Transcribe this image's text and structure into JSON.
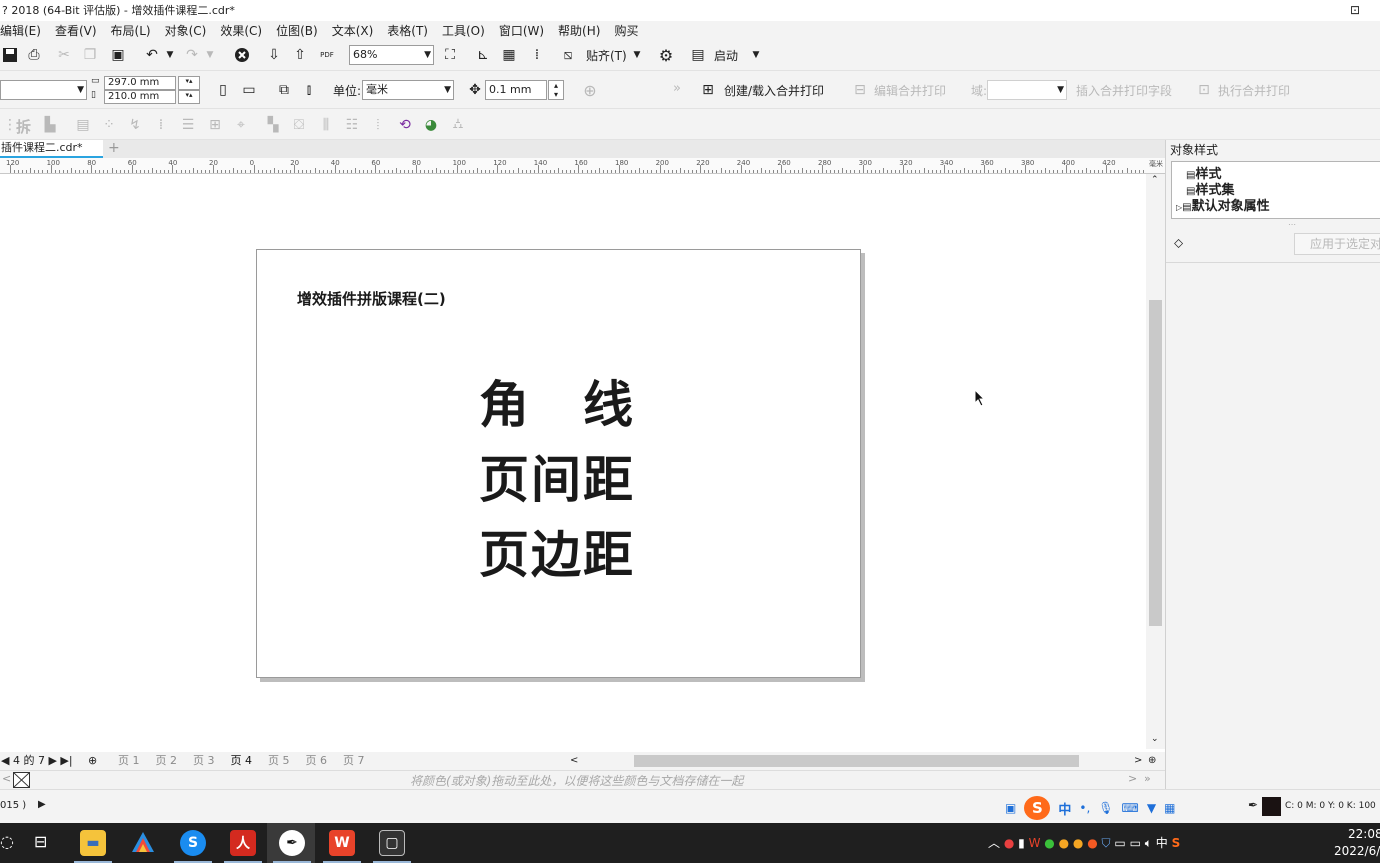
{
  "window": {
    "title": "? 2018 (64-Bit 评估版) - 增效插件课程二.cdr*"
  },
  "menu": [
    "编辑(E)",
    "查看(V)",
    "布局(L)",
    "对象(C)",
    "效果(C)",
    "位图(B)",
    "文本(X)",
    "表格(T)",
    "工具(O)",
    "窗口(W)",
    "帮助(H)",
    "购买"
  ],
  "toolbar1": {
    "zoom_value": "68%",
    "snap_label": "贴齐(T)",
    "launch_label": "启动",
    "pdf_label": "PDF"
  },
  "toolbar2": {
    "width_value": "297.0 mm",
    "height_value": "210.0 mm",
    "unit_label": "单位:",
    "unit_value": "毫米",
    "nudge_value": "0.1 mm",
    "create_merge_label": "创建/载入合并打印",
    "edit_merge_label": "编辑合并打印",
    "field_label": "域:",
    "insert_field_label": "插入合并打印字段",
    "run_merge_label": "执行合并打印",
    "overflow": "»"
  },
  "toolbar3": {
    "split_label": "拆"
  },
  "document_tab": {
    "label": "插件课程二.cdr*",
    "add": "+"
  },
  "ruler": {
    "labels": [
      "120",
      "100",
      "80",
      "60",
      "40",
      "20",
      "0",
      "20",
      "40",
      "60",
      "80",
      "100",
      "120",
      "140",
      "160",
      "180",
      "200",
      "220",
      "240",
      "260",
      "280",
      "300",
      "320",
      "340",
      "360",
      "380",
      "400",
      "420"
    ],
    "unit": "毫米"
  },
  "page": {
    "title": "增效插件拼版课程(二)",
    "line1": "角　线",
    "line2": "页间距",
    "line3": "页边距"
  },
  "pagebar": {
    "nav": "◀ 4 的 7 ▶ ▶|",
    "tabs": [
      "页 1",
      "页 2",
      "页 3",
      "页 4",
      "页 5",
      "页 6",
      "页 7"
    ],
    "active_index": 3
  },
  "palette": {
    "hint": "将颜色(或对象)拖动至此处，以便将这些颜色与文档存储在一起"
  },
  "status": {
    "left": "015 )",
    "fill_info": "C: 0 M: 0 Y: 0 K: 100"
  },
  "docker": {
    "title": "对象样式",
    "items": [
      "样式",
      "样式集",
      "默认对象属性"
    ],
    "apply_label": "应用于选定对"
  },
  "taskbar": {
    "tray_ime": "中",
    "tray_lang": "中",
    "clock_time": "22:08",
    "clock_date": "2022/6/"
  }
}
